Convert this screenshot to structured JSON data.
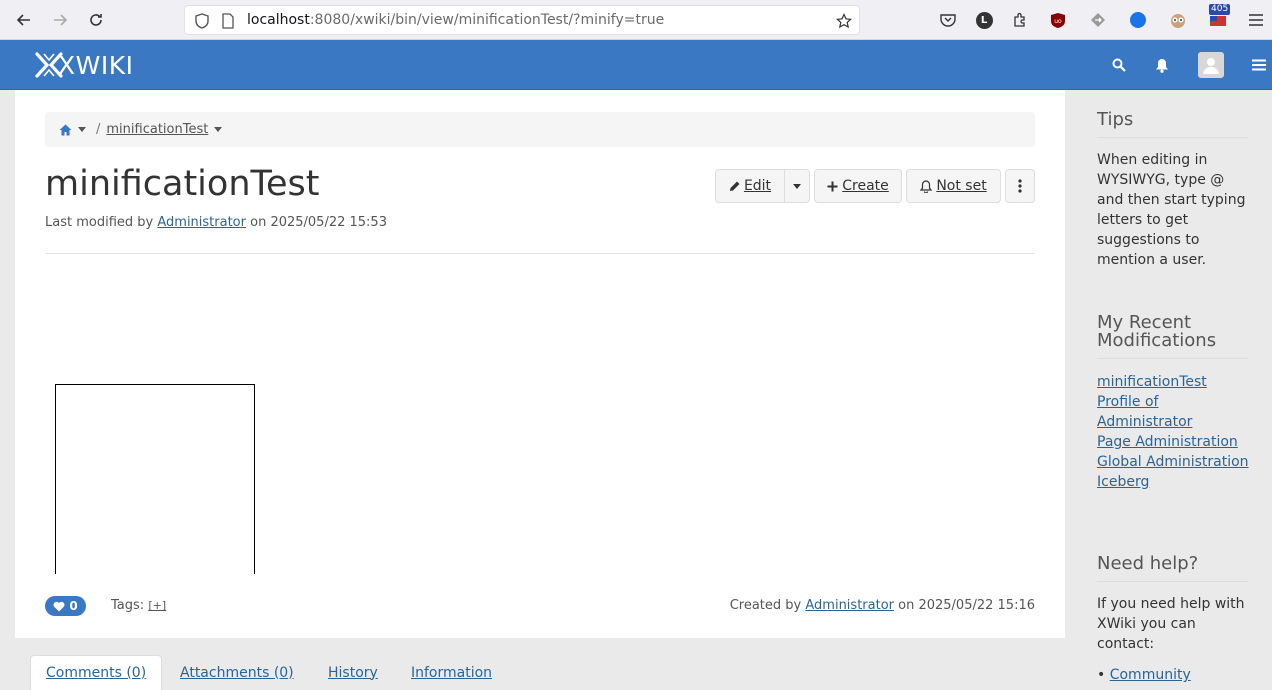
{
  "browser": {
    "url_host": "localhost",
    "url_rest": ":8080/xwiki/bin/view/minificationTest/?minify=true",
    "ext_badge": "405"
  },
  "header": {
    "logo": "XWIKI"
  },
  "breadcrumb": {
    "page": "minificationTest"
  },
  "page": {
    "title": "minificationTest",
    "last_modified_prefix": "Last modified by",
    "last_modified_user": "Administrator",
    "last_modified_on": "on 2025/05/22 15:53"
  },
  "actions": {
    "edit": "Edit",
    "create": "Create",
    "notify": "Not set"
  },
  "footer": {
    "likes": "0",
    "tags_label": "Tags:",
    "tags_add": "[+]",
    "created_prefix": "Created by",
    "created_user": "Administrator",
    "created_on": "on 2025/05/22 15:16"
  },
  "tabs": [
    {
      "label": "Comments (0)"
    },
    {
      "label": "Attachments (0)"
    },
    {
      "label": "History"
    },
    {
      "label": "Information"
    }
  ],
  "sidebar": {
    "tips_title": "Tips",
    "tips_text": "When editing in WYSIWYG, type @ and then start typing letters to get suggestions to mention a user.",
    "recent_title": "My Recent Modifications",
    "recent": [
      "minificationTest",
      "Profile of Administrator",
      "Page Administration",
      "Global Administration",
      "Iceberg"
    ],
    "help_title": "Need help?",
    "help_text": "If you need help with XWiki you can contact:",
    "help_link": "Community"
  },
  "colors": {
    "brand": "#3a78c4",
    "link": "#2a6496"
  }
}
